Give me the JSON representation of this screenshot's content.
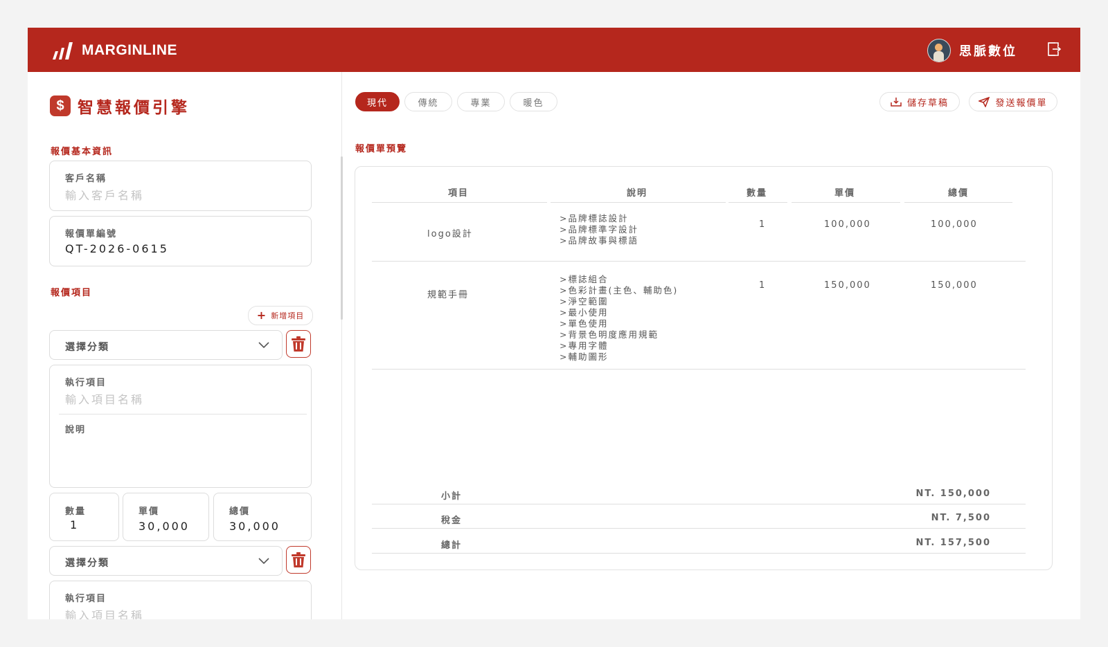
{
  "header": {
    "brand": "MARGINLINE",
    "user_name": "思脈數位",
    "logout_icon": "logout-icon"
  },
  "sidebar": {
    "app_title": "智慧報價引擎",
    "app_icon": "dollar-icon",
    "basic_info_label": "報價基本資訊",
    "client_name": {
      "label": "客戶名稱",
      "placeholder": "輸入客戶名稱",
      "value": ""
    },
    "quote_number": {
      "label": "報價單編號",
      "value": "QT-2026-0615"
    },
    "items_label": "報價項目",
    "add_item_label": "新增項目",
    "items": [
      {
        "category_placeholder": "選擇分類",
        "task_label": "執行項目",
        "task_placeholder": "輸入項目名稱",
        "desc_label": "說明",
        "qty_label": "數量",
        "qty_value": "1",
        "price_label": "單價",
        "price_value": "30,000",
        "total_label": "總價",
        "total_value": "30,000"
      },
      {
        "category_placeholder": "選擇分類",
        "task_label": "執行項目",
        "task_placeholder": "輸入項目名稱"
      }
    ]
  },
  "main": {
    "tabs": [
      {
        "label": "現代",
        "active": true
      },
      {
        "label": "傳統",
        "active": false
      },
      {
        "label": "專業",
        "active": false
      },
      {
        "label": "暖色",
        "active": false
      }
    ],
    "save_draft_label": "儲存草稿",
    "send_quote_label": "發送報價單",
    "preview_label": "報價單預覽",
    "table": {
      "headers": [
        "項目",
        "說明",
        "數量",
        "單價",
        "總價"
      ],
      "rows": [
        {
          "item": "logo設計",
          "desc": ">品牌標誌設計\n>品牌標準字設計\n>品牌故事與標語",
          "qty": "1",
          "price": "100,000",
          "total": "100,000"
        },
        {
          "item": "規範手冊",
          "desc": ">標誌組合\n>色彩計畫(主色、輔助色)\n>淨空範圍\n>最小使用\n>單色使用\n>背景色明度應用規範\n>專用字體\n>輔助圖形",
          "qty": "1",
          "price": "150,000",
          "total": "150,000"
        }
      ]
    },
    "summary": {
      "subtotal_label": "小計",
      "subtotal": "NT. 150,000",
      "tax_label": "稅金",
      "tax": "NT. 7,500",
      "total_label": "總計",
      "total": "NT. 157,500"
    }
  },
  "colors": {
    "accent": "#b5271d",
    "background": "#f3f3f3"
  }
}
